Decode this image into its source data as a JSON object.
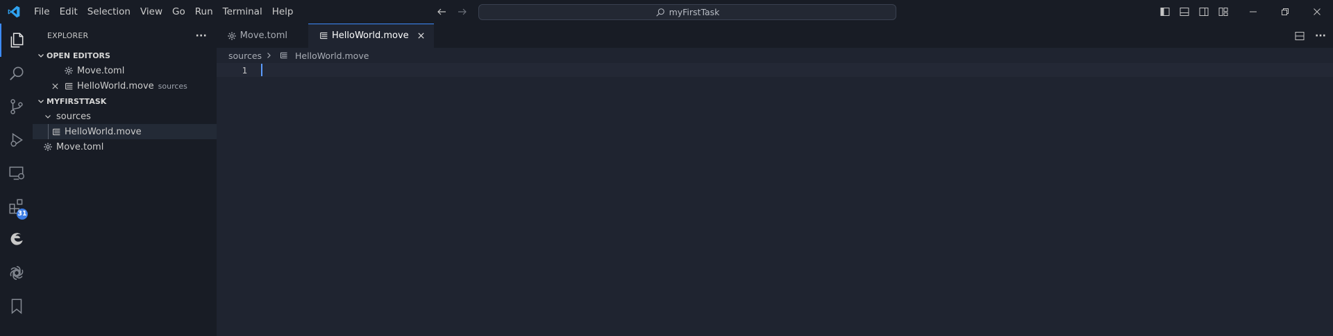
{
  "titlebar": {
    "menu": [
      "File",
      "Edit",
      "Selection",
      "View",
      "Go",
      "Run",
      "Terminal",
      "Help"
    ],
    "search_text": "myFirstTask"
  },
  "activity": {
    "extensions_badge": "31"
  },
  "sidebar": {
    "title": "EXPLORER",
    "more_actions": "···",
    "open_editors": {
      "header": "OPEN EDITORS",
      "items": [
        {
          "name": "Move.toml",
          "desc": ""
        },
        {
          "name": "HelloWorld.move",
          "desc": "sources"
        }
      ]
    },
    "project": {
      "header": "MYFIRSTTASK",
      "folder": "sources",
      "folder_file": "HelloWorld.move",
      "root_file": "Move.toml"
    }
  },
  "editor": {
    "tabs": [
      {
        "label": "Move.toml",
        "active": false
      },
      {
        "label": "HelloWorld.move",
        "active": true
      }
    ],
    "breadcrumb": {
      "folder": "sources",
      "file": "HelloWorld.move"
    },
    "line_number": "1"
  },
  "colors": {
    "accent": "#3d8bfd",
    "badge": "#3d7ee6",
    "logo": "#2fa2f0"
  }
}
